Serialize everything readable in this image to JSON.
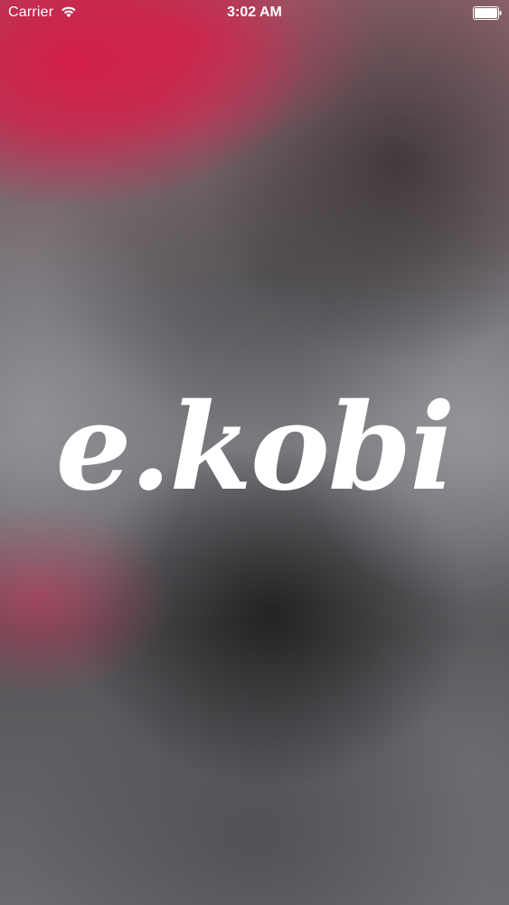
{
  "status_bar": {
    "carrier": "Carrier",
    "time": "3:02 AM",
    "wifi_icon": "wifi-icon",
    "battery_icon": "battery-icon"
  },
  "splash": {
    "logo_text": "e.kobi",
    "logo_color": "#ffffff",
    "accent_color": "#d61c48"
  }
}
